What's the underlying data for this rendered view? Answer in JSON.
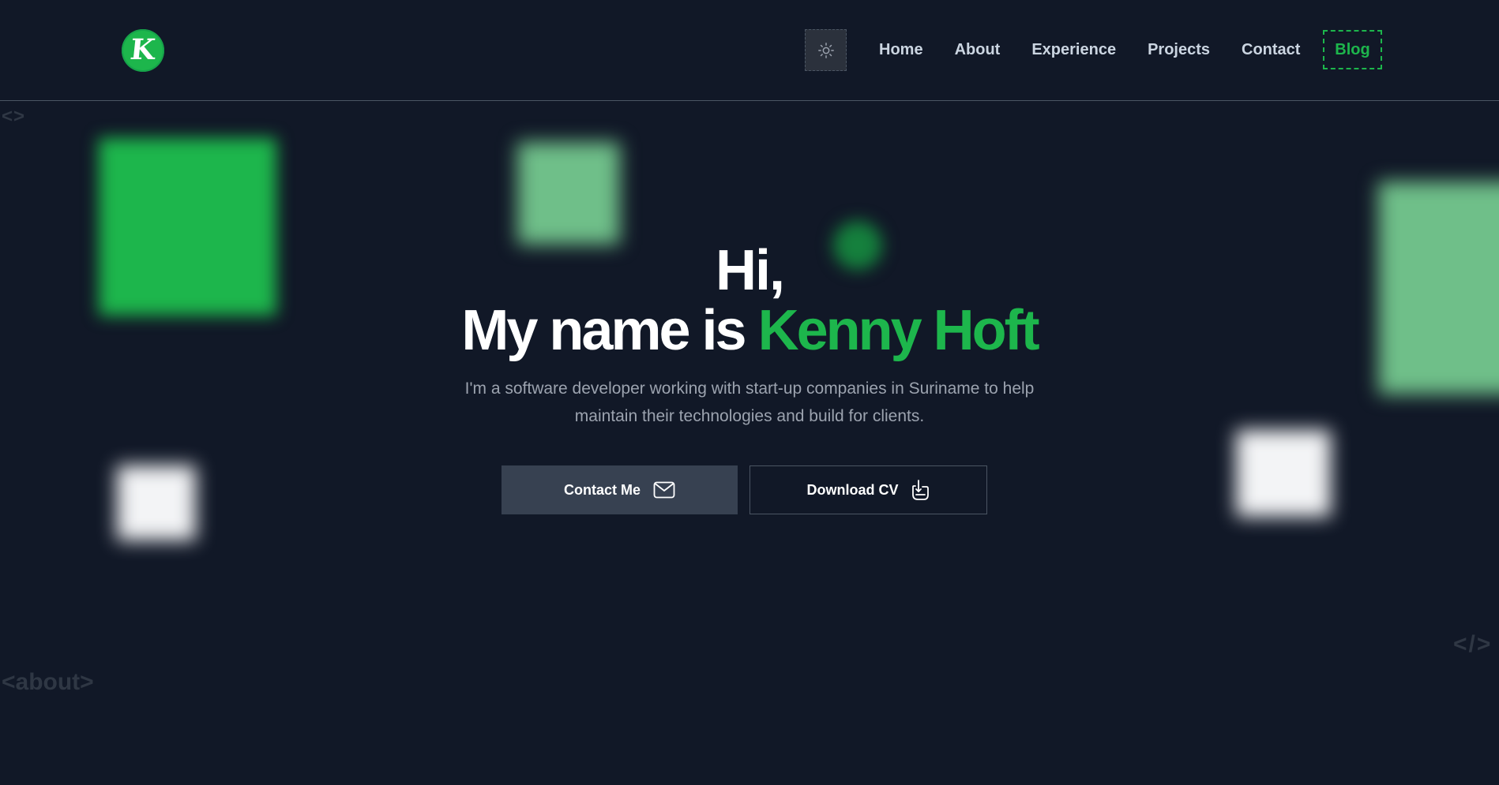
{
  "header": {
    "logo_letter": "K",
    "nav": [
      "Home",
      "About",
      "Experience",
      "Projects",
      "Contact"
    ],
    "blog_label": "Blog"
  },
  "hero": {
    "greeting": "Hi,",
    "name_prefix": "My name is",
    "name": "Kenny Hoft",
    "intro_line1": "I'm a software developer working with start-up companies in Suriname to help",
    "intro_line2": "maintain their technologies and build for clients.",
    "contact_label": "Contact Me",
    "download_label": "Download CV"
  },
  "decor": {
    "tag_top": "<>",
    "tag_right": "</>",
    "tag_about": "<about>"
  },
  "colors": {
    "background": "#111827",
    "accent": "#1db64c",
    "button": "#374151"
  },
  "icons": {
    "theme": "sun-icon",
    "contact": "mail-icon",
    "download": "download-hand-icon"
  }
}
